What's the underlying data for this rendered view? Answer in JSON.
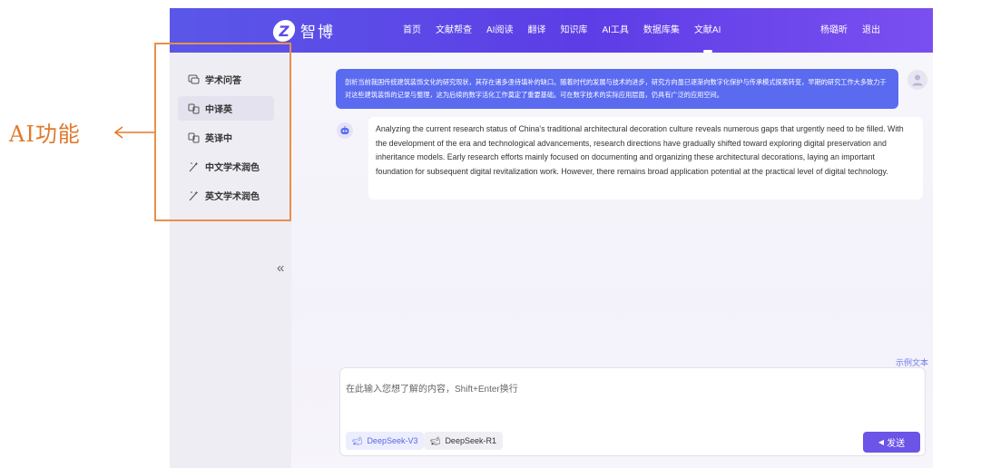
{
  "annotation": {
    "label": "AI功能",
    "color": "#e07a2e"
  },
  "header": {
    "logo_text": "智博",
    "nav": [
      "首页",
      "文献帮查",
      "AI阅读",
      "翻译",
      "知识库",
      "AI工具",
      "数据库集",
      "文献AI"
    ],
    "active_nav": "文献AI",
    "username": "杨璐昕",
    "logout": "退出"
  },
  "sidebar": {
    "items": [
      {
        "label": "学术问答",
        "icon": "chat-icon"
      },
      {
        "label": "中译英",
        "icon": "translate-icon"
      },
      {
        "label": "英译中",
        "icon": "translate-icon"
      },
      {
        "label": "中文学术润色",
        "icon": "magic-wand-icon"
      },
      {
        "label": "英文学术润色",
        "icon": "magic-wand-icon"
      }
    ],
    "active_index": 1,
    "collapse_symbol": "«"
  },
  "chat": {
    "user_message": "剖析当前我国传统建筑装饰文化的研究现状，其存在诸多亟待填补的缺口。随着时代的发展与技术的进步，研究方向虽已逐渐向数字化保护与传承模式探索转变，早期的研究工作大多致力于对这些建筑装饰的记录与整理，这为后续的数字活化工作奠定了重要基础。可在数字技术的实际应用层面，仍具有广泛的应用空间。",
    "bot_message": "Analyzing the current research status of China's traditional architectural decoration culture reveals numerous gaps that urgently need to be filled. With the development of the era and technological advancements, research directions have gradually shifted toward exploring digital preservation and inheritance models. Early research efforts mainly focused on documenting and organizing these architectural decorations, laying an important foundation for subsequent digital revitalization work. However, there remains broad application potential at the practical level of digital technology."
  },
  "composer": {
    "example_link": "示例文本",
    "placeholder": "在此输入您想了解的内容，Shift+Enter换行",
    "models": [
      "DeepSeek-V3",
      "DeepSeek-R1"
    ],
    "send_label": "发送"
  },
  "colors": {
    "topbar": "#5a4be6",
    "user_bubble": "#5a6bf0",
    "send_button": "#6b54e6",
    "highlight": "#e8904a"
  }
}
